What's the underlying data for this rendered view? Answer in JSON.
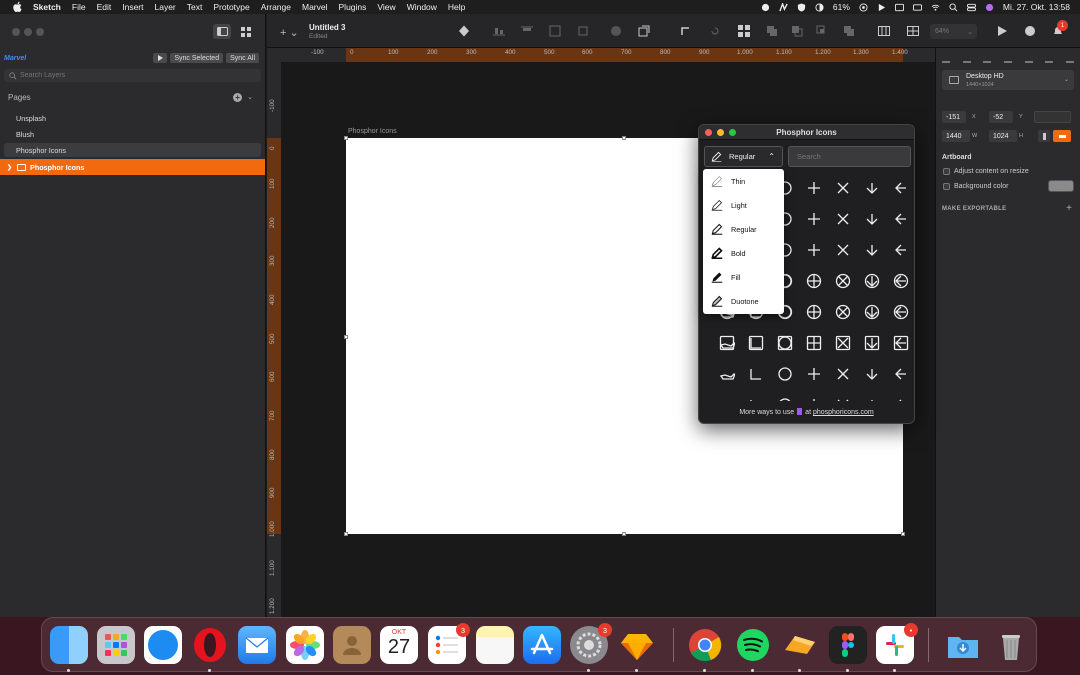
{
  "menubar": {
    "app_name": "Sketch",
    "menus": [
      "File",
      "Edit",
      "Insert",
      "Layer",
      "Text",
      "Prototype",
      "Arrange",
      "Marvel",
      "Plugins",
      "View",
      "Window",
      "Help"
    ],
    "battery": "61%",
    "datetime": "Mi. 27. Okt.  13:58",
    "notification_badge": "1"
  },
  "sidebar": {
    "marvel_logo": "Marvel",
    "sync_selected": "Sync Selected",
    "sync_all": "Sync All",
    "search_placeholder": "Search Layers",
    "pages_header": "Pages",
    "pages": [
      "Unsplash",
      "Blush",
      "Phosphor Icons"
    ],
    "layer": "Phosphor Icons"
  },
  "toolbar": {
    "document_title": "Untitled 3",
    "document_status": "Edited",
    "zoom": "64%"
  },
  "rulers": {
    "top_labels": [
      "-100",
      "0",
      "100",
      "200",
      "300",
      "400",
      "500",
      "600",
      "700",
      "800",
      "900",
      "1.000",
      "1.100",
      "1.200",
      "1.300",
      "1.400"
    ],
    "left_labels": [
      "-100",
      "0",
      "100",
      "200",
      "300",
      "400",
      "500",
      "600",
      "700",
      "800",
      "900",
      "1.000",
      "1.100",
      "1.200"
    ]
  },
  "canvas": {
    "artboard_label": "Phosphor Icons"
  },
  "inspector": {
    "preset_name": "Desktop HD",
    "preset_size": "1440×1024",
    "x": "-151",
    "x_label": "X",
    "y": "-52",
    "y_label": "Y",
    "w": "1440",
    "w_label": "W",
    "h": "1024",
    "h_label": "H",
    "artboard_heading": "Artboard",
    "adjust_label": "Adjust content on resize",
    "bg_color_label": "Background color",
    "export_heading": "MAKE EXPORTABLE"
  },
  "plugin": {
    "title": "Phosphor Icons",
    "weight_selected": "Regular",
    "search_placeholder": "Search",
    "weights": [
      "Thin",
      "Light",
      "Regular",
      "Bold",
      "Fill",
      "Duotone"
    ],
    "footer_text": "More ways to use",
    "footer_at": "at",
    "footer_link": "phosphoricons.com"
  },
  "dock": {
    "calendar_month": "OKT",
    "calendar_day": "27",
    "reminders_badge": "3",
    "settings_badge": "3"
  },
  "colors": {
    "accent": "#f26a10",
    "marvel_blue": "#3a8ef6"
  }
}
